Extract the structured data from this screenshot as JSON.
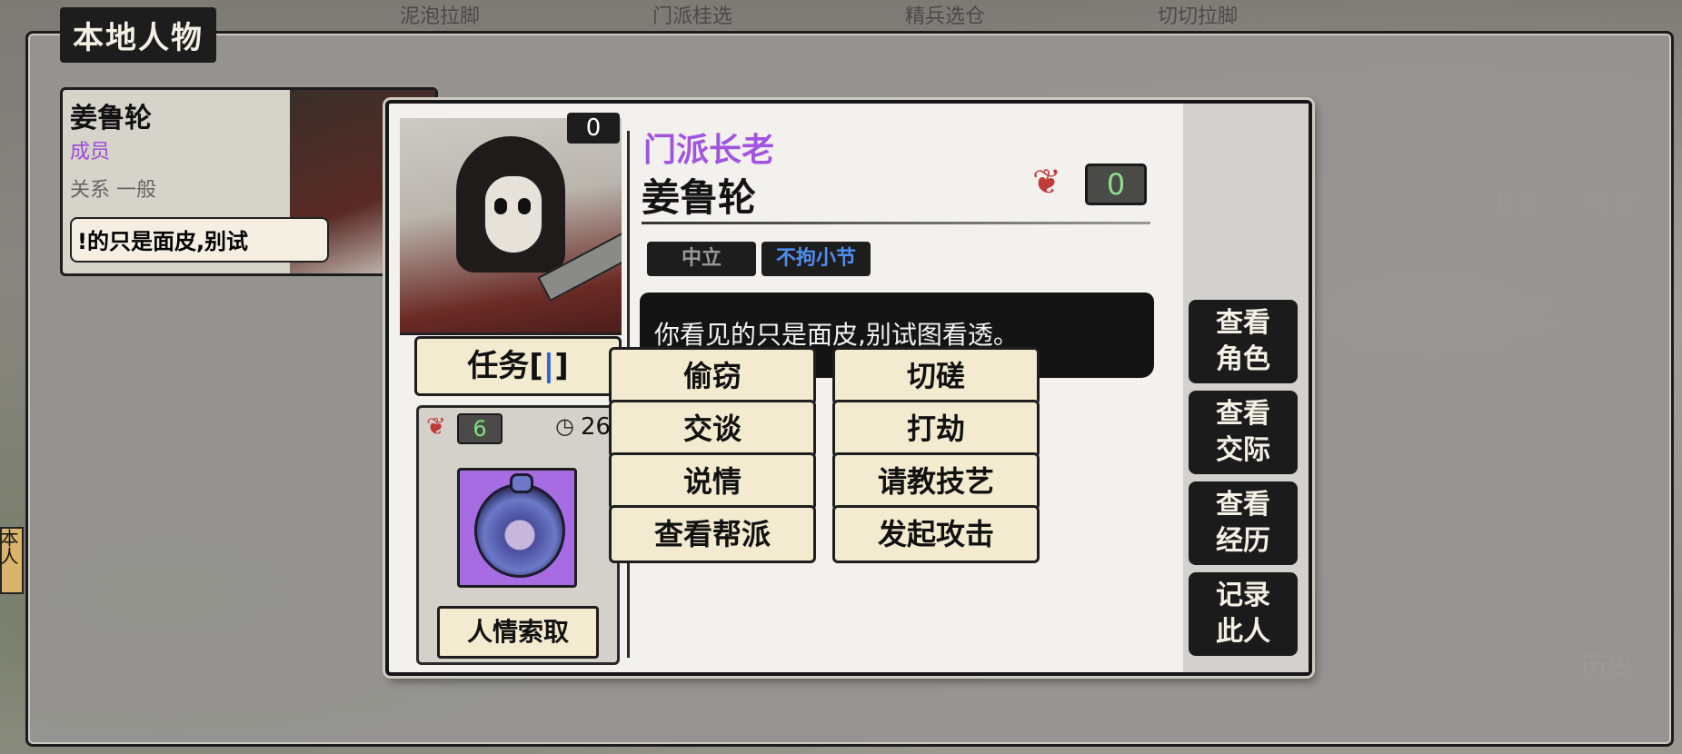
{
  "top_tabs": [
    "泥泡拉脚",
    "门派桂选",
    "精兵选仓",
    "切切拉脚"
  ],
  "panel": {
    "title": "本地人物"
  },
  "npc_card": {
    "name": "姜鲁轮",
    "rank": "成员",
    "relation": "关系 一般",
    "quote": "!的只是面皮,别试"
  },
  "side_tab": "本人",
  "background_buttons": [
    "追踪",
    "曾建"
  ],
  "background_history": "历史",
  "dialog": {
    "portrait_count": "0",
    "task_label": "任务[",
    "task_mark": "|",
    "task_close": "]",
    "favor_value": "6",
    "timer_value": "26",
    "demand_label": "人情索取",
    "sect_rank": "门派长老",
    "name": "姜鲁轮",
    "favor_top": "0",
    "tags": [
      "中立",
      "不拘小节"
    ],
    "speech": "你看见的只是面皮,别试图看透。",
    "actions": [
      "偷窃",
      "切磋",
      "交谈",
      "打劫",
      "说情",
      "请教技艺",
      "查看帮派",
      "发起攻击"
    ],
    "side_buttons": [
      {
        "line1": "查看",
        "line2": "角色"
      },
      {
        "line1": "查看",
        "line2": "交际"
      },
      {
        "line1": "查看",
        "line2": "经历"
      },
      {
        "line1": "记录",
        "line2": "此人"
      }
    ]
  },
  "colors": {
    "sect_rank": "#a054e0",
    "trait_tag": "#4f8ef0",
    "favor_green": "#8be08b",
    "button_fill": "#f3ebcf"
  }
}
